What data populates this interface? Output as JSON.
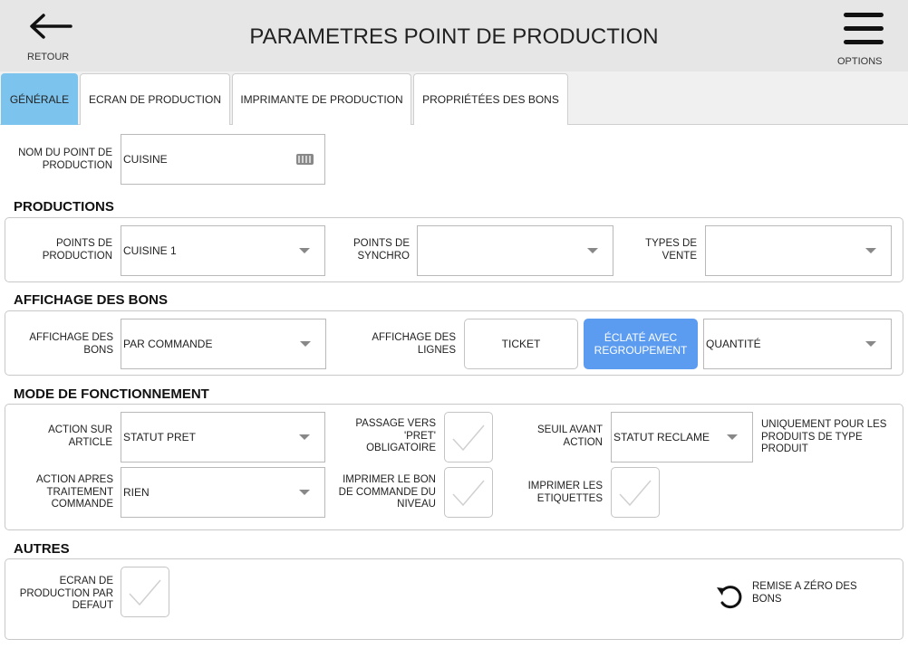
{
  "header": {
    "back_label": "RETOUR",
    "title": "PARAMETRES POINT DE PRODUCTION",
    "options_label": "OPTIONS"
  },
  "tabs": [
    "GÉNÉRALE",
    "ECRAN DE PRODUCTION",
    "IMPRIMANTE DE PRODUCTION",
    "PROPRIÉTÉES DES BONS"
  ],
  "general": {
    "name_label": "NOM DU POINT DE PRODUCTION",
    "name_value": "CUISINE"
  },
  "productions": {
    "title": "PRODUCTIONS",
    "points_label": "POINTS DE PRODUCTION",
    "points_value": "CUISINE 1",
    "synchro_label": "POINTS DE SYNCHRO",
    "synchro_value": "",
    "types_label": "TYPES DE VENTE",
    "types_value": ""
  },
  "affichage": {
    "title": "AFFICHAGE DES BONS",
    "bons_label": "AFFICHAGE DES BONS",
    "bons_value": "PAR COMMANDE",
    "lignes_label": "AFFICHAGE DES LIGNES",
    "ticket_label": "TICKET",
    "eclate_label": "ÉCLATÉ AVEC REGROUPEMENT",
    "quantite_value": "QUANTITÉ"
  },
  "mode": {
    "title": "MODE DE FONCTIONNEMENT",
    "action_article_label": "ACTION SUR ARTICLE",
    "action_article_value": "STATUT PRET",
    "passage_label": "PASSAGE VERS 'PRET' OBLIGATOIRE",
    "seuil_label": "SEUIL AVANT ACTION",
    "seuil_value": "STATUT RECLAME",
    "seuil_note": "UNIQUEMENT POUR LES PRODUITS DE TYPE PRODUIT",
    "action_apres_label": "ACTION APRES TRAITEMENT COMMANDE",
    "action_apres_value": "RIEN",
    "imprimer_bon_label": "IMPRIMER LE BON DE COMMANDE DU NIVEAU",
    "imprimer_etiquettes_label": "IMPRIMER LES ETIQUETTES"
  },
  "autres": {
    "title": "AUTRES",
    "ecran_label": "ECRAN DE PRODUCTION PAR DEFAUT",
    "reset_label": "REMISE A ZÉRO DES BONS"
  },
  "colors": {
    "header_bg": "#e6e6e6",
    "tab_active": "#7cc4ee",
    "toggle_active": "#5b9cf0"
  },
  "icons": [
    "arrow-left-icon",
    "hamburger-menu-icon",
    "keyboard-icon",
    "chevron-down-icon",
    "checkmark-icon",
    "reset-icon"
  ]
}
